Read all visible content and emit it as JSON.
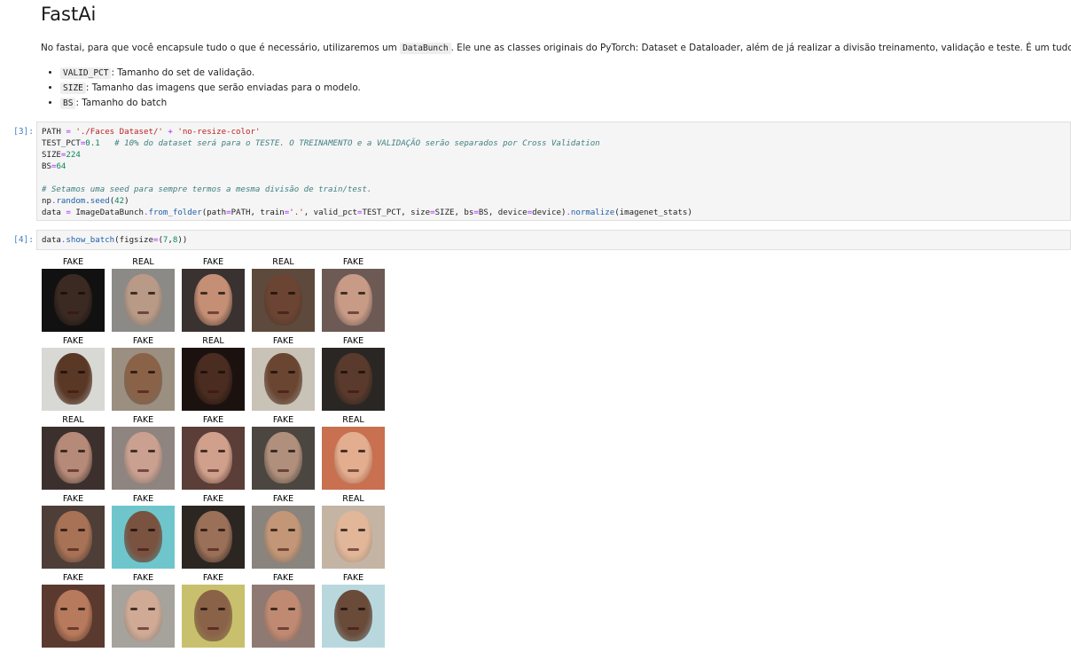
{
  "notebook": {
    "heading": "FastAi",
    "paragraph": {
      "before": "No fastai, para que você encapsule tudo o que é necessário, utilizaremos um ",
      "code": "DataBunch",
      "after": ". Ele une as classes originais do PyTorch: Dataset e Dataloader, além de já realizar a divisão treinamento, validação e teste. É um tudo em um."
    },
    "bullets": [
      {
        "code": "VALID_PCT",
        "text": ": Tamanho do set de validação."
      },
      {
        "code": "SIZE",
        "text": ": Tamanho das imagens que serão enviadas para o modelo."
      },
      {
        "code": "BS",
        "text": ": Tamanho do batch"
      }
    ]
  },
  "cells": [
    {
      "prompt": "[3]:",
      "lines": [
        [
          {
            "t": "PATH "
          },
          {
            "t": "=",
            "c": "op"
          },
          {
            "t": " "
          },
          {
            "t": "'./Faces Dataset/'",
            "c": "str"
          },
          {
            "t": " "
          },
          {
            "t": "+",
            "c": "op"
          },
          {
            "t": " "
          },
          {
            "t": "'no-resize-color'",
            "c": "str"
          }
        ],
        [
          {
            "t": "TEST_PCT"
          },
          {
            "t": "=",
            "c": "op"
          },
          {
            "t": "0.1",
            "c": "num"
          },
          {
            "t": "   "
          },
          {
            "t": "# 10% do dataset será para o TESTE. O TREINAMENTO e a VALIDAÇÃO serão separados por Cross Validation",
            "c": "com"
          }
        ],
        [
          {
            "t": "SIZE"
          },
          {
            "t": "=",
            "c": "op"
          },
          {
            "t": "224",
            "c": "num"
          }
        ],
        [
          {
            "t": "BS"
          },
          {
            "t": "=",
            "c": "op"
          },
          {
            "t": "64",
            "c": "num"
          }
        ],
        [
          {
            "t": ""
          }
        ],
        [
          {
            "t": "# Setamos uma seed para sempre termos a mesma divisão de train/test.",
            "c": "com"
          }
        ],
        [
          {
            "t": "np"
          },
          {
            "t": ".",
            "c": "op"
          },
          {
            "t": "random",
            "c": "fn"
          },
          {
            "t": "."
          },
          {
            "t": "seed",
            "c": "fn"
          },
          {
            "t": "("
          },
          {
            "t": "42",
            "c": "num"
          },
          {
            "t": ")"
          }
        ],
        [
          {
            "t": "data "
          },
          {
            "t": "=",
            "c": "op"
          },
          {
            "t": " ImageDataBunch"
          },
          {
            "t": ".",
            "c": "op"
          },
          {
            "t": "from_folder",
            "c": "fn"
          },
          {
            "t": "(path"
          },
          {
            "t": "=",
            "c": "op"
          },
          {
            "t": "PATH, train"
          },
          {
            "t": "=",
            "c": "op"
          },
          {
            "t": "'.'",
            "c": "str"
          },
          {
            "t": ", valid_pct"
          },
          {
            "t": "=",
            "c": "op"
          },
          {
            "t": "TEST_PCT, size"
          },
          {
            "t": "=",
            "c": "op"
          },
          {
            "t": "SIZE, bs"
          },
          {
            "t": "=",
            "c": "op"
          },
          {
            "t": "BS, device"
          },
          {
            "t": "=",
            "c": "op"
          },
          {
            "t": "device)"
          },
          {
            "t": ".",
            "c": "op"
          },
          {
            "t": "normalize",
            "c": "fn"
          },
          {
            "t": "(imagenet_stats)"
          }
        ]
      ]
    },
    {
      "prompt": "[4]:",
      "lines": [
        [
          {
            "t": "data"
          },
          {
            "t": ".",
            "c": "op"
          },
          {
            "t": "show_batch",
            "c": "fn"
          },
          {
            "t": "(figsize"
          },
          {
            "t": "=",
            "c": "op"
          },
          {
            "t": "("
          },
          {
            "t": "7",
            "c": "num"
          },
          {
            "t": ","
          },
          {
            "t": "8",
            "c": "num"
          },
          {
            "t": "))"
          }
        ]
      ]
    }
  ],
  "batch_output": {
    "items": [
      {
        "label": "FAKE",
        "bg": "#111111",
        "skin": "#3b2a22"
      },
      {
        "label": "REAL",
        "bg": "#8c8a86",
        "skin": "#b89a86"
      },
      {
        "label": "FAKE",
        "bg": "#3a3230",
        "skin": "#c48f74"
      },
      {
        "label": "REAL",
        "bg": "#5e4a3c",
        "skin": "#6b4433"
      },
      {
        "label": "FAKE",
        "bg": "#6d5a55",
        "skin": "#c89b86"
      },
      {
        "label": "FAKE",
        "bg": "#d8d8d4",
        "skin": "#5a3826"
      },
      {
        "label": "FAKE",
        "bg": "#9a8f80",
        "skin": "#8a6248"
      },
      {
        "label": "REAL",
        "bg": "#1b1210",
        "skin": "#4a2c20"
      },
      {
        "label": "FAKE",
        "bg": "#c9c2b6",
        "skin": "#6a4632"
      },
      {
        "label": "FAKE",
        "bg": "#2a2624",
        "skin": "#5a3a2c"
      },
      {
        "label": "REAL",
        "bg": "#3c302e",
        "skin": "#b68a78"
      },
      {
        "label": "FAKE",
        "bg": "#8e8480",
        "skin": "#caa090"
      },
      {
        "label": "FAKE",
        "bg": "#5b3e38",
        "skin": "#d0a08c"
      },
      {
        "label": "FAKE",
        "bg": "#4c4640",
        "skin": "#b0907c"
      },
      {
        "label": "REAL",
        "bg": "#c87050",
        "skin": "#e3ad8f"
      },
      {
        "label": "FAKE",
        "bg": "#4d3e38",
        "skin": "#a87256"
      },
      {
        "label": "FAKE",
        "bg": "#6ec6cc",
        "skin": "#7a5240"
      },
      {
        "label": "FAKE",
        "bg": "#2c2622",
        "skin": "#9a7058"
      },
      {
        "label": "FAKE",
        "bg": "#8a847e",
        "skin": "#c29676"
      },
      {
        "label": "REAL",
        "bg": "#c4b4a4",
        "skin": "#e2b698"
      },
      {
        "label": "FAKE",
        "bg": "#5a3a2e",
        "skin": "#b87a5c"
      },
      {
        "label": "FAKE",
        "bg": "#a6a29c",
        "skin": "#d0aa94"
      },
      {
        "label": "FAKE",
        "bg": "#c8c06c",
        "skin": "#8a6248"
      },
      {
        "label": "FAKE",
        "bg": "#8e7a72",
        "skin": "#c08a72"
      },
      {
        "label": "FAKE",
        "bg": "#b8d8de",
        "skin": "#6a4a38"
      }
    ]
  },
  "colors": {
    "prompt": "#3f7fbf",
    "cell_bg": "#f5f5f5",
    "cell_border": "#e0e0e0"
  }
}
